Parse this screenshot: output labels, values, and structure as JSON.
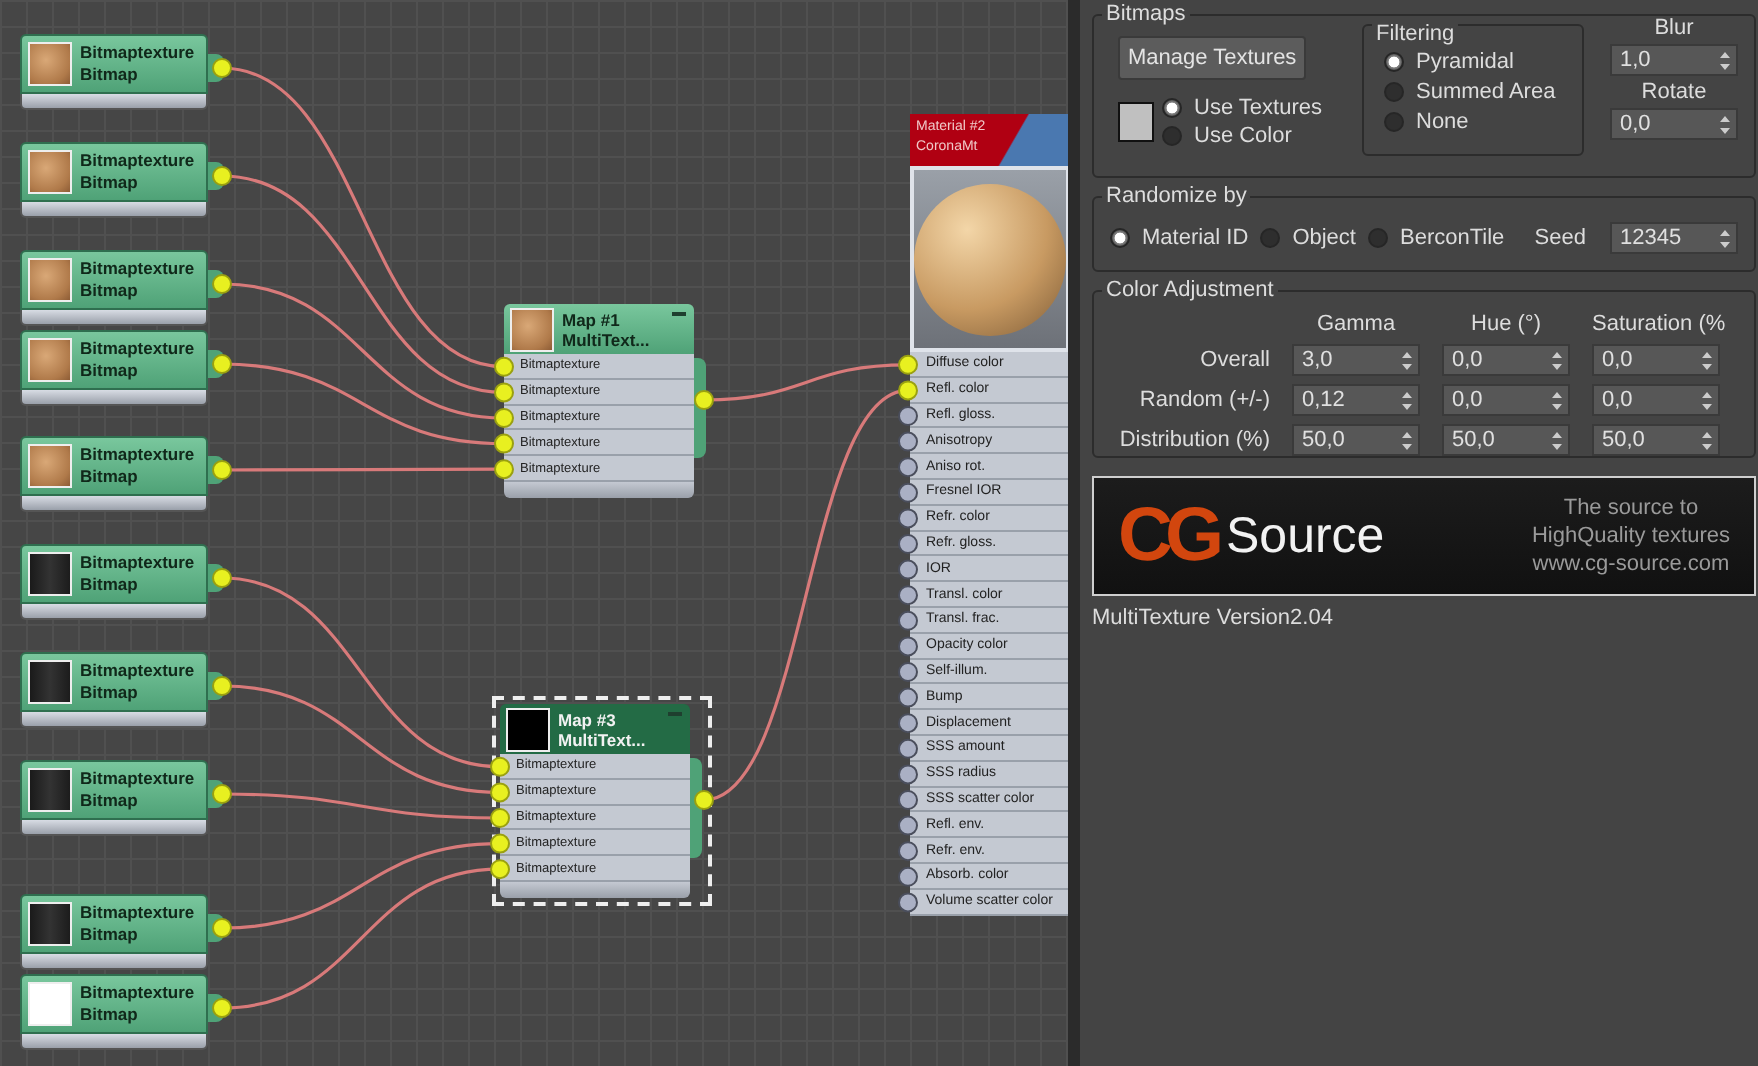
{
  "node_editor": {
    "maps": [
      {
        "title": "Map #1",
        "subtitle": "MultiText...",
        "selected": false,
        "kind": "wood",
        "inputs": [
          {
            "title": "Bitmaptexture",
            "subtitle": "Bitmap",
            "kind": "wood",
            "slot": "Bitmaptexture"
          },
          {
            "title": "Bitmaptexture",
            "subtitle": "Bitmap",
            "kind": "wood",
            "slot": "Bitmaptexture"
          },
          {
            "title": "Bitmaptexture",
            "subtitle": "Bitmap",
            "kind": "wood",
            "slot": "Bitmaptexture"
          },
          {
            "title": "Bitmaptexture",
            "subtitle": "Bitmap",
            "kind": "wood",
            "slot": "Bitmaptexture"
          },
          {
            "title": "Bitmaptexture",
            "subtitle": "Bitmap",
            "kind": "wood",
            "slot": "Bitmaptexture"
          }
        ]
      },
      {
        "title": "Map #3",
        "subtitle": "MultiText...",
        "selected": true,
        "kind": "black",
        "inputs": [
          {
            "title": "Bitmaptexture",
            "subtitle": "Bitmap",
            "kind": "dark",
            "slot": "Bitmaptexture"
          },
          {
            "title": "Bitmaptexture",
            "subtitle": "Bitmap",
            "kind": "dark",
            "slot": "Bitmaptexture"
          },
          {
            "title": "Bitmaptexture",
            "subtitle": "Bitmap",
            "kind": "dark",
            "slot": "Bitmaptexture"
          },
          {
            "title": "Bitmaptexture",
            "subtitle": "Bitmap",
            "kind": "dark",
            "slot": "Bitmaptexture"
          },
          {
            "title": "Bitmaptexture",
            "subtitle": "Bitmap",
            "kind": "white",
            "slot": "Bitmaptexture"
          }
        ]
      }
    ],
    "material": {
      "title": "Material #2",
      "subtitle": "CoronaMt",
      "slots": [
        {
          "label": "Diffuse color",
          "connected": true
        },
        {
          "label": "Refl. color",
          "connected": true
        },
        {
          "label": "Refl. gloss.",
          "connected": false
        },
        {
          "label": "Anisotropy",
          "connected": false
        },
        {
          "label": "Aniso rot.",
          "connected": false
        },
        {
          "label": "Fresnel IOR",
          "connected": false
        },
        {
          "label": "Refr. color",
          "connected": false
        },
        {
          "label": "Refr. gloss.",
          "connected": false
        },
        {
          "label": "IOR",
          "connected": false
        },
        {
          "label": "Transl. color",
          "connected": false
        },
        {
          "label": "Transl. frac.",
          "connected": false
        },
        {
          "label": "Opacity color",
          "connected": false
        },
        {
          "label": "Self-illum.",
          "connected": false
        },
        {
          "label": "Bump",
          "connected": false
        },
        {
          "label": "Displacement",
          "connected": false
        },
        {
          "label": "SSS amount",
          "connected": false
        },
        {
          "label": "SSS radius",
          "connected": false
        },
        {
          "label": "SSS scatter color",
          "connected": false
        },
        {
          "label": "Refl. env.",
          "connected": false
        },
        {
          "label": "Refr. env.",
          "connected": false
        },
        {
          "label": "Absorb. color",
          "connected": false
        },
        {
          "label": "Volume scatter color",
          "connected": false
        }
      ]
    }
  },
  "bitmaps": {
    "title": "Bitmaps",
    "manage_button": "Manage Textures",
    "source_options": [
      {
        "label": "Use Textures",
        "selected": true
      },
      {
        "label": "Use Color",
        "selected": false
      }
    ],
    "filtering": {
      "title": "Filtering",
      "options": [
        {
          "label": "Pyramidal",
          "selected": true
        },
        {
          "label": "Summed Area",
          "selected": false
        },
        {
          "label": "None",
          "selected": false
        }
      ]
    },
    "blur": {
      "label": "Blur",
      "value": "1,0"
    },
    "rotate": {
      "label": "Rotate",
      "value": "0,0"
    }
  },
  "randomize": {
    "title": "Randomize by",
    "options": [
      {
        "label": "Material ID",
        "selected": true
      },
      {
        "label": "Object",
        "selected": false
      },
      {
        "label": "BerconTile",
        "selected": false
      }
    ],
    "seed_label": "Seed",
    "seed": "12345"
  },
  "color_adjustment": {
    "title": "Color Adjustment",
    "columns": [
      "Gamma",
      "Hue (°)",
      "Saturation (%"
    ],
    "rows": [
      {
        "label": "Overall",
        "values": [
          "3,0",
          "0,0",
          "0,0"
        ]
      },
      {
        "label": "Random (+/-)",
        "values": [
          "0,12",
          "0,0",
          "0,0"
        ]
      },
      {
        "label": "Distribution (%)",
        "values": [
          "50,0",
          "50,0",
          "50,0"
        ]
      }
    ]
  },
  "banner": {
    "brand_mark": "CG",
    "brand_name": "Source",
    "tagline": [
      "The source to",
      "HighQuality textures",
      "www.cg-source.com"
    ]
  },
  "version": "MultiTexture Version2.04"
}
